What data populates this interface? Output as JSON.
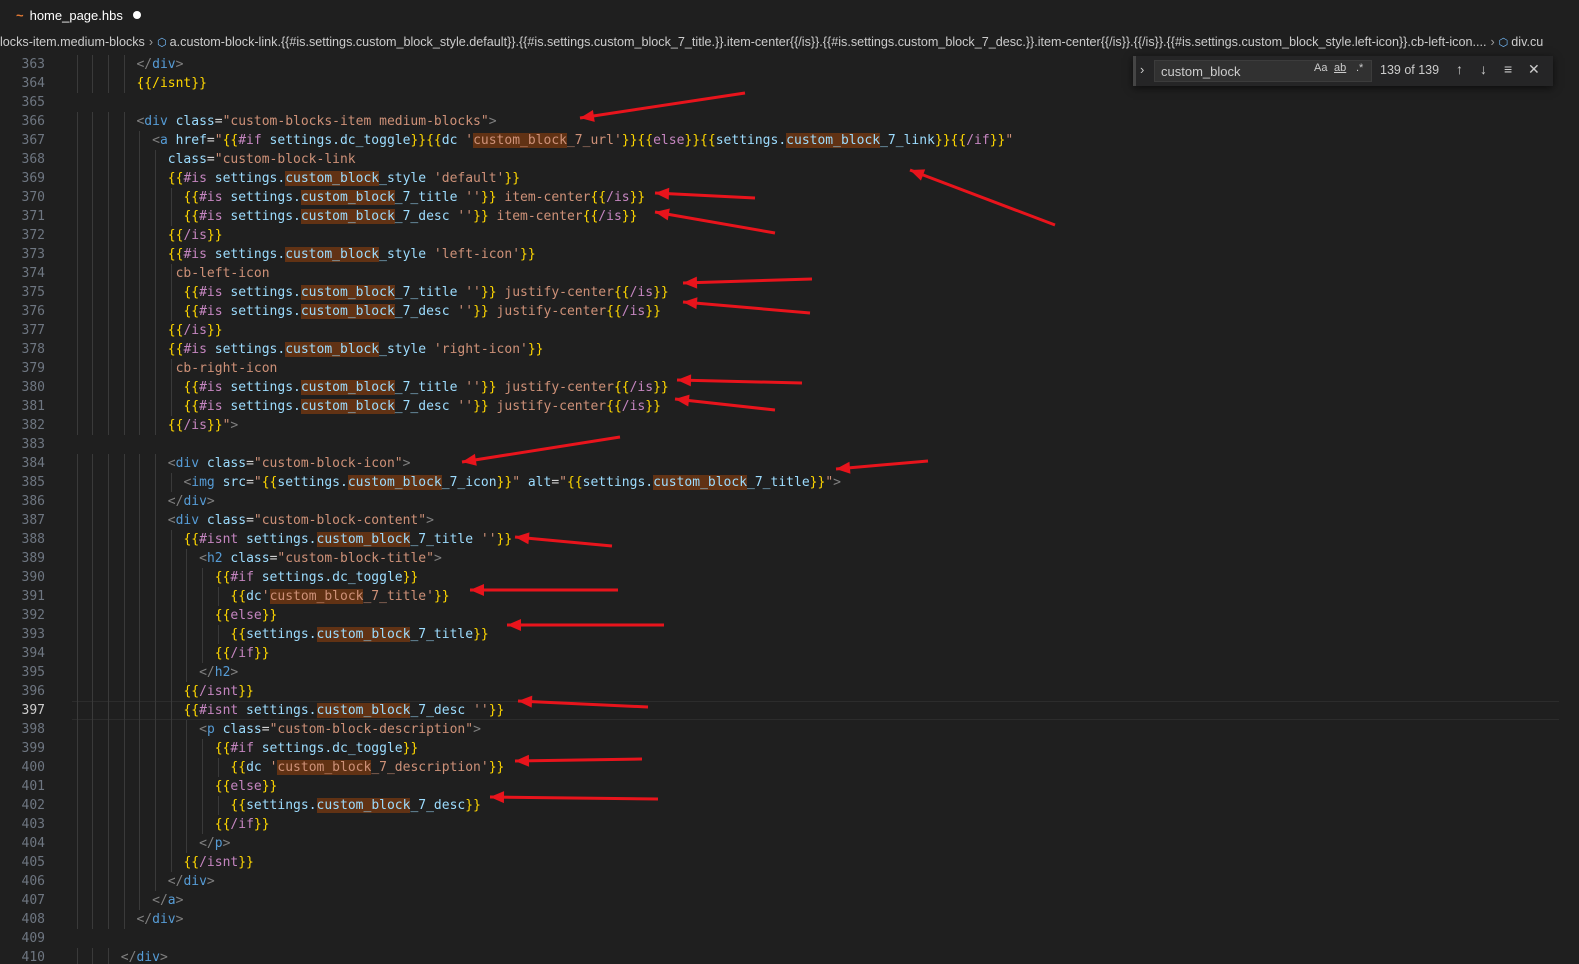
{
  "tab": {
    "icon": "handlebars-icon",
    "name": "home_page.hbs",
    "modified": true
  },
  "breadcrumb": {
    "first": "locks-item.medium-blocks",
    "second": "a.custom-block-link.{{#is.settings.custom_block_style.default}}.{{#is.settings.custom_block_7_title.}}.item-center{{/is}}.{{#is.settings.custom_block_7_desc.}}.item-center{{/is}}.{{/is}}.{{#is.settings.custom_block_style.left-icon}}.cb-left-icon....",
    "third": "div.cu"
  },
  "find": {
    "query": "custom_block",
    "count": "139 of 139",
    "match_case": "Aa",
    "whole_word": "ab",
    "regex": ".*"
  },
  "lines": [
    {
      "n": "363",
      "i": 9,
      "t": [
        [
          "tg",
          "</"
        ],
        [
          "tn",
          "div"
        ],
        [
          "tg",
          ">"
        ]
      ]
    },
    {
      "n": "364",
      "i": 9,
      "t": [
        [
          "br",
          "{{/isnt}}"
        ]
      ]
    },
    {
      "n": "365",
      "i": 0,
      "t": []
    },
    {
      "n": "366",
      "i": 9,
      "t": [
        [
          "tg",
          "<"
        ],
        [
          "tn",
          "div"
        ],
        [
          "an",
          " class"
        ],
        [
          "pn",
          "="
        ],
        [
          "av",
          "\"custom-blocks-item medium-blocks\""
        ],
        [
          "tg",
          ">"
        ]
      ]
    },
    {
      "n": "367",
      "i": 11,
      "t": [
        [
          "tg",
          "<"
        ],
        [
          "tn",
          "a"
        ],
        [
          "an",
          " href"
        ],
        [
          "pn",
          "="
        ],
        [
          "av",
          "\""
        ],
        [
          "br",
          "{{"
        ],
        [
          "kw",
          "#if"
        ],
        [
          "pl",
          " settings.dc_toggle"
        ],
        [
          "br",
          "}}{{"
        ],
        [
          "pl",
          "dc "
        ],
        [
          "st",
          "'"
        ],
        [
          "st_m",
          "custom_block"
        ],
        [
          "st",
          "_7_url'"
        ],
        [
          "br",
          "}}{{"
        ],
        [
          "kw",
          "else"
        ],
        [
          "br",
          "}}{{"
        ],
        [
          "pl",
          "settings."
        ],
        [
          "pl_m",
          "custom_block"
        ],
        [
          "pl",
          "_7_link"
        ],
        [
          "br",
          "}}{{"
        ],
        [
          "kw",
          "/if"
        ],
        [
          "br",
          "}}"
        ],
        [
          "av",
          "\""
        ]
      ]
    },
    {
      "n": "368",
      "i": 13,
      "t": [
        [
          "an",
          "class"
        ],
        [
          "pn",
          "="
        ],
        [
          "av",
          "\"custom-block-link"
        ]
      ]
    },
    {
      "n": "369",
      "i": 13,
      "t": [
        [
          "br",
          "{{"
        ],
        [
          "kw",
          "#is"
        ],
        [
          "pl",
          " settings."
        ],
        [
          "pl_m",
          "custom_block"
        ],
        [
          "pl",
          "_style "
        ],
        [
          "st",
          "'default'"
        ],
        [
          "br",
          "}}"
        ]
      ]
    },
    {
      "n": "370",
      "i": 15,
      "t": [
        [
          "br",
          "{{"
        ],
        [
          "kw",
          "#is"
        ],
        [
          "pl",
          " settings."
        ],
        [
          "pl_m",
          "custom_block"
        ],
        [
          "pl",
          "_7_title "
        ],
        [
          "st",
          "''"
        ],
        [
          "br",
          "}}"
        ],
        [
          "av",
          " item-center"
        ],
        [
          "br",
          "{{"
        ],
        [
          "kw",
          "/is"
        ],
        [
          "br",
          "}}"
        ]
      ]
    },
    {
      "n": "371",
      "i": 15,
      "t": [
        [
          "br",
          "{{"
        ],
        [
          "kw",
          "#is"
        ],
        [
          "pl",
          " settings."
        ],
        [
          "pl_m",
          "custom_block"
        ],
        [
          "pl",
          "_7_desc "
        ],
        [
          "st",
          "''"
        ],
        [
          "br",
          "}}"
        ],
        [
          "av",
          " item-center"
        ],
        [
          "br",
          "{{"
        ],
        [
          "kw",
          "/is"
        ],
        [
          "br",
          "}}"
        ]
      ]
    },
    {
      "n": "372",
      "i": 13,
      "t": [
        [
          "br",
          "{{"
        ],
        [
          "kw",
          "/is"
        ],
        [
          "br",
          "}}"
        ]
      ]
    },
    {
      "n": "373",
      "i": 13,
      "t": [
        [
          "br",
          "{{"
        ],
        [
          "kw",
          "#is"
        ],
        [
          "pl",
          " settings."
        ],
        [
          "pl_m",
          "custom_block"
        ],
        [
          "pl",
          "_style "
        ],
        [
          "st",
          "'left-icon'"
        ],
        [
          "br",
          "}}"
        ]
      ]
    },
    {
      "n": "374",
      "i": 14,
      "t": [
        [
          "av",
          "cb-left-icon"
        ]
      ]
    },
    {
      "n": "375",
      "i": 15,
      "t": [
        [
          "br",
          "{{"
        ],
        [
          "kw",
          "#is"
        ],
        [
          "pl",
          " settings."
        ],
        [
          "pl_m",
          "custom_block"
        ],
        [
          "pl",
          "_7_title "
        ],
        [
          "st",
          "''"
        ],
        [
          "br",
          "}}"
        ],
        [
          "av",
          " justify-center"
        ],
        [
          "br",
          "{{"
        ],
        [
          "kw",
          "/is"
        ],
        [
          "br",
          "}}"
        ]
      ]
    },
    {
      "n": "376",
      "i": 15,
      "t": [
        [
          "br",
          "{{"
        ],
        [
          "kw",
          "#is"
        ],
        [
          "pl",
          " settings."
        ],
        [
          "pl_m",
          "custom_block"
        ],
        [
          "pl",
          "_7_desc "
        ],
        [
          "st",
          "''"
        ],
        [
          "br",
          "}}"
        ],
        [
          "av",
          " justify-center"
        ],
        [
          "br",
          "{{"
        ],
        [
          "kw",
          "/is"
        ],
        [
          "br",
          "}}"
        ]
      ]
    },
    {
      "n": "377",
      "i": 13,
      "t": [
        [
          "br",
          "{{"
        ],
        [
          "kw",
          "/is"
        ],
        [
          "br",
          "}}"
        ]
      ]
    },
    {
      "n": "378",
      "i": 13,
      "t": [
        [
          "br",
          "{{"
        ],
        [
          "kw",
          "#is"
        ],
        [
          "pl",
          " settings."
        ],
        [
          "pl_m",
          "custom_block"
        ],
        [
          "pl",
          "_style "
        ],
        [
          "st",
          "'right-icon'"
        ],
        [
          "br",
          "}}"
        ]
      ]
    },
    {
      "n": "379",
      "i": 14,
      "t": [
        [
          "av",
          "cb-right-icon"
        ]
      ]
    },
    {
      "n": "380",
      "i": 15,
      "t": [
        [
          "br",
          "{{"
        ],
        [
          "kw",
          "#is"
        ],
        [
          "pl",
          " settings."
        ],
        [
          "pl_m",
          "custom_block"
        ],
        [
          "pl",
          "_7_title "
        ],
        [
          "st",
          "''"
        ],
        [
          "br",
          "}}"
        ],
        [
          "av",
          " justify-center"
        ],
        [
          "br",
          "{{"
        ],
        [
          "kw",
          "/is"
        ],
        [
          "br",
          "}}"
        ]
      ]
    },
    {
      "n": "381",
      "i": 15,
      "t": [
        [
          "br",
          "{{"
        ],
        [
          "kw",
          "#is"
        ],
        [
          "pl",
          " settings."
        ],
        [
          "pl_m",
          "custom_block"
        ],
        [
          "pl",
          "_7_desc "
        ],
        [
          "st",
          "''"
        ],
        [
          "br",
          "}}"
        ],
        [
          "av",
          " justify-center"
        ],
        [
          "br",
          "{{"
        ],
        [
          "kw",
          "/is"
        ],
        [
          "br",
          "}}"
        ]
      ]
    },
    {
      "n": "382",
      "i": 13,
      "t": [
        [
          "br",
          "{{"
        ],
        [
          "kw",
          "/is"
        ],
        [
          "br",
          "}}"
        ],
        [
          "av",
          "\""
        ],
        [
          "tg",
          ">"
        ]
      ]
    },
    {
      "n": "383",
      "i": 0,
      "t": []
    },
    {
      "n": "384",
      "i": 13,
      "t": [
        [
          "tg",
          "<"
        ],
        [
          "tn",
          "div"
        ],
        [
          "an",
          " class"
        ],
        [
          "pn",
          "="
        ],
        [
          "av",
          "\"custom-block-icon\""
        ],
        [
          "tg",
          ">"
        ]
      ]
    },
    {
      "n": "385",
      "i": 15,
      "t": [
        [
          "tg",
          "<"
        ],
        [
          "tn",
          "img"
        ],
        [
          "an",
          " src"
        ],
        [
          "pn",
          "="
        ],
        [
          "av",
          "\""
        ],
        [
          "br",
          "{{"
        ],
        [
          "pl",
          "settings."
        ],
        [
          "pl_m",
          "custom_block"
        ],
        [
          "pl",
          "_7_icon"
        ],
        [
          "br",
          "}}"
        ],
        [
          "av",
          "\""
        ],
        [
          "an",
          " alt"
        ],
        [
          "pn",
          "="
        ],
        [
          "av",
          "\""
        ],
        [
          "br",
          "{{"
        ],
        [
          "pl",
          "settings."
        ],
        [
          "pl_m",
          "custom_block"
        ],
        [
          "pl",
          "_7_title"
        ],
        [
          "br",
          "}}"
        ],
        [
          "av",
          "\""
        ],
        [
          "tg",
          ">"
        ]
      ]
    },
    {
      "n": "386",
      "i": 13,
      "t": [
        [
          "tg",
          "</"
        ],
        [
          "tn",
          "div"
        ],
        [
          "tg",
          ">"
        ]
      ]
    },
    {
      "n": "387",
      "i": 13,
      "t": [
        [
          "tg",
          "<"
        ],
        [
          "tn",
          "div"
        ],
        [
          "an",
          " class"
        ],
        [
          "pn",
          "="
        ],
        [
          "av",
          "\"custom-block-content\""
        ],
        [
          "tg",
          ">"
        ]
      ]
    },
    {
      "n": "388",
      "i": 15,
      "t": [
        [
          "br",
          "{{"
        ],
        [
          "kw",
          "#isnt"
        ],
        [
          "pl",
          " settings."
        ],
        [
          "pl_m",
          "custom_block"
        ],
        [
          "pl",
          "_7_title "
        ],
        [
          "st",
          "''"
        ],
        [
          "br",
          "}}"
        ]
      ]
    },
    {
      "n": "389",
      "i": 17,
      "t": [
        [
          "tg",
          "<"
        ],
        [
          "tn",
          "h2"
        ],
        [
          "an",
          " class"
        ],
        [
          "pn",
          "="
        ],
        [
          "av",
          "\"custom-block-title\""
        ],
        [
          "tg",
          ">"
        ]
      ]
    },
    {
      "n": "390",
      "i": 19,
      "t": [
        [
          "br",
          "{{"
        ],
        [
          "kw",
          "#if"
        ],
        [
          "pl",
          " settings.dc_toggle"
        ],
        [
          "br",
          "}}"
        ]
      ]
    },
    {
      "n": "391",
      "i": 21,
      "t": [
        [
          "br",
          "{{"
        ],
        [
          "pl",
          "dc"
        ],
        [
          "st",
          "'"
        ],
        [
          "st_m",
          "custom_block"
        ],
        [
          "st",
          "_7_title'"
        ],
        [
          "br",
          "}}"
        ]
      ]
    },
    {
      "n": "392",
      "i": 19,
      "t": [
        [
          "br",
          "{{"
        ],
        [
          "kw",
          "else"
        ],
        [
          "br",
          "}}"
        ]
      ]
    },
    {
      "n": "393",
      "i": 21,
      "t": [
        [
          "br",
          "{{"
        ],
        [
          "pl",
          "settings."
        ],
        [
          "pl_m",
          "custom_block"
        ],
        [
          "pl",
          "_7_title"
        ],
        [
          "br",
          "}}"
        ]
      ]
    },
    {
      "n": "394",
      "i": 19,
      "t": [
        [
          "br",
          "{{"
        ],
        [
          "kw",
          "/if"
        ],
        [
          "br",
          "}}"
        ]
      ]
    },
    {
      "n": "395",
      "i": 17,
      "t": [
        [
          "tg",
          "</"
        ],
        [
          "tn",
          "h2"
        ],
        [
          "tg",
          ">"
        ]
      ]
    },
    {
      "n": "396",
      "i": 15,
      "t": [
        [
          "br",
          "{{"
        ],
        [
          "kw",
          "/isnt"
        ],
        [
          "br",
          "}}"
        ]
      ]
    },
    {
      "n": "397",
      "i": 15,
      "t": [
        [
          "br",
          "{{"
        ],
        [
          "kw",
          "#isnt"
        ],
        [
          "pl",
          " settings."
        ],
        [
          "pl_m",
          "custom_block"
        ],
        [
          "pl",
          "_7_desc "
        ],
        [
          "st",
          "''"
        ],
        [
          "br",
          "}}"
        ]
      ],
      "current": true
    },
    {
      "n": "398",
      "i": 17,
      "t": [
        [
          "tg",
          "<"
        ],
        [
          "tn",
          "p"
        ],
        [
          "an",
          " class"
        ],
        [
          "pn",
          "="
        ],
        [
          "av",
          "\"custom-block-description\""
        ],
        [
          "tg",
          ">"
        ]
      ]
    },
    {
      "n": "399",
      "i": 19,
      "t": [
        [
          "br",
          "{{"
        ],
        [
          "kw",
          "#if"
        ],
        [
          "pl",
          " settings.dc_toggle"
        ],
        [
          "br",
          "}}"
        ]
      ]
    },
    {
      "n": "400",
      "i": 21,
      "t": [
        [
          "br",
          "{{"
        ],
        [
          "pl",
          "dc "
        ],
        [
          "st",
          "'"
        ],
        [
          "st_m",
          "custom_block"
        ],
        [
          "st",
          "_7_description'"
        ],
        [
          "br",
          "}}"
        ]
      ]
    },
    {
      "n": "401",
      "i": 19,
      "t": [
        [
          "br",
          "{{"
        ],
        [
          "kw",
          "else"
        ],
        [
          "br",
          "}}"
        ]
      ]
    },
    {
      "n": "402",
      "i": 21,
      "t": [
        [
          "br",
          "{{"
        ],
        [
          "pl",
          "settings."
        ],
        [
          "pl_m",
          "custom_block"
        ],
        [
          "pl",
          "_7_desc"
        ],
        [
          "br",
          "}}"
        ]
      ]
    },
    {
      "n": "403",
      "i": 19,
      "t": [
        [
          "br",
          "{{"
        ],
        [
          "kw",
          "/if"
        ],
        [
          "br",
          "}}"
        ]
      ]
    },
    {
      "n": "404",
      "i": 17,
      "t": [
        [
          "tg",
          "</"
        ],
        [
          "tn",
          "p"
        ],
        [
          "tg",
          ">"
        ]
      ]
    },
    {
      "n": "405",
      "i": 15,
      "t": [
        [
          "br",
          "{{"
        ],
        [
          "kw",
          "/isnt"
        ],
        [
          "br",
          "}}"
        ]
      ]
    },
    {
      "n": "406",
      "i": 13,
      "t": [
        [
          "tg",
          "</"
        ],
        [
          "tn",
          "div"
        ],
        [
          "tg",
          ">"
        ]
      ]
    },
    {
      "n": "407",
      "i": 11,
      "t": [
        [
          "tg",
          "</"
        ],
        [
          "tn",
          "a"
        ],
        [
          "tg",
          ">"
        ]
      ]
    },
    {
      "n": "408",
      "i": 9,
      "t": [
        [
          "tg",
          "</"
        ],
        [
          "tn",
          "div"
        ],
        [
          "tg",
          ">"
        ]
      ]
    },
    {
      "n": "409",
      "i": 0,
      "t": []
    },
    {
      "n": "410",
      "i": 7,
      "t": [
        [
          "tg",
          "</"
        ],
        [
          "tn",
          "div"
        ],
        [
          "tg",
          ">"
        ]
      ]
    }
  ],
  "annotation_color": "#e8141c"
}
